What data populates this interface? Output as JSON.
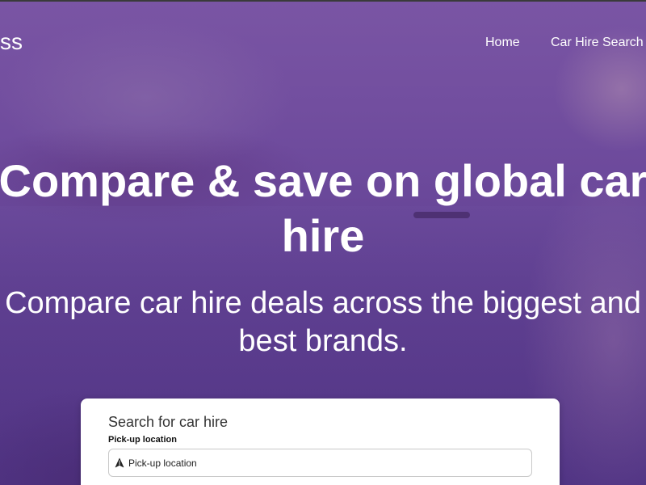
{
  "header": {
    "logo_text": "ss",
    "nav": [
      {
        "label": "Home"
      },
      {
        "label": "Car Hire Search"
      }
    ]
  },
  "hero": {
    "headline_line1": "Compare & save on global car",
    "headline_line2": "hire",
    "subhead_line1": "Compare car hire deals across the biggest and",
    "subhead_line2": "best brands."
  },
  "search": {
    "title": "Search for car hire",
    "pickup_label": "Pick-up location",
    "pickup_placeholder": "Pick-up location",
    "pickup_icon": "navigation-arrow-icon"
  },
  "colors": {
    "overlay": "#6d4a9c",
    "text": "#ffffff",
    "card": "#ffffff"
  }
}
